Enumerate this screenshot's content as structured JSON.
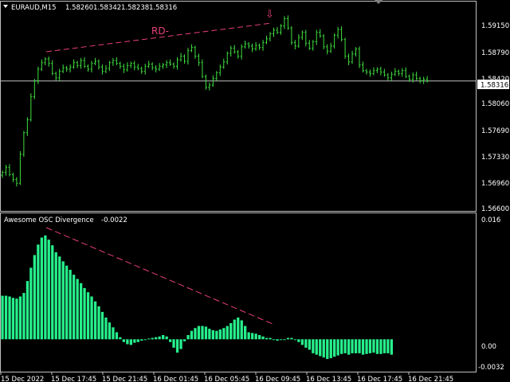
{
  "chart_data": [
    {
      "type": "line",
      "symbol": "EURAUD,M15",
      "ohlc": {
        "open": "1.58260",
        "high": "1.58342",
        "low": "1.58238",
        "close": "1.58316"
      },
      "ylim": [
        1.5655,
        1.5935
      ],
      "y_ticks": [
        "1.59150",
        "1.58790",
        "1.58420",
        "1.58060",
        "1.57690",
        "1.57330",
        "1.56960",
        "1.56600"
      ],
      "current_price_label": "1.58316",
      "current_price": 1.58316,
      "divergence_label": "RD-",
      "arrow_glyph": "⇩",
      "x_tick_labels": [
        "15 Dec 2022",
        "15 Dec 17:45",
        "15 Dec 21:45",
        "16 Dec 01:45",
        "16 Dec 05:45",
        "16 Dec 09:45",
        "16 Dec 13:45",
        "16 Dec 17:45",
        "16 Dec 21:45"
      ],
      "close_series": [
        1.5705,
        1.5712,
        1.5702,
        1.5695,
        1.569,
        1.573,
        1.576,
        1.5778,
        1.581,
        1.5832,
        1.5848,
        1.5857,
        1.5862,
        1.5856,
        1.5842,
        1.5836,
        1.5845,
        1.585,
        1.5848,
        1.5851,
        1.5857,
        1.5853,
        1.586,
        1.5852,
        1.5848,
        1.5856,
        1.5859,
        1.5851,
        1.5845,
        1.5849,
        1.5857,
        1.586,
        1.5856,
        1.5852,
        1.5847,
        1.5853,
        1.5856,
        1.5851,
        1.5849,
        1.5845,
        1.5852,
        1.5855,
        1.585,
        1.5848,
        1.5852,
        1.5854,
        1.5857,
        1.5855,
        1.5852,
        1.5861,
        1.5866,
        1.5859,
        1.5874,
        1.5878,
        1.5866,
        1.5857,
        1.5838,
        1.5823,
        1.5826,
        1.5835,
        1.5843,
        1.5851,
        1.5858,
        1.587,
        1.5877,
        1.5872,
        1.5866,
        1.5879,
        1.5883,
        1.588,
        1.5876,
        1.5881,
        1.5878,
        1.5885,
        1.589,
        1.5897,
        1.5902,
        1.5899,
        1.5908,
        1.5918,
        1.5905,
        1.5885,
        1.588,
        1.5892,
        1.5899,
        1.5884,
        1.5877,
        1.5886,
        1.5899,
        1.5894,
        1.5879,
        1.5873,
        1.588,
        1.5895,
        1.5903,
        1.5889,
        1.5866,
        1.5858,
        1.5869,
        1.5876,
        1.5854,
        1.5846,
        1.5844,
        1.5842,
        1.5846,
        1.5848,
        1.5844,
        1.584,
        1.5836,
        1.5841,
        1.5845,
        1.5842,
        1.5846,
        1.5838,
        1.5834,
        1.584,
        1.5835,
        1.5832,
        1.5834,
        1.5832
      ]
    },
    {
      "type": "bar",
      "indicator_name": "Awesome OSC Divergence",
      "indicator_value": "-0.0022",
      "ylim": [
        -0.0045,
        0.0175
      ],
      "y_ticks": [
        "0.016",
        "0.00",
        "-0.0032"
      ],
      "values": [
        0.0062,
        0.0062,
        0.0061,
        0.0059,
        0.0058,
        0.0061,
        0.0066,
        0.0083,
        0.0102,
        0.012,
        0.0135,
        0.0145,
        0.0148,
        0.0142,
        0.0134,
        0.0124,
        0.0118,
        0.0111,
        0.0105,
        0.0099,
        0.0092,
        0.0086,
        0.008,
        0.0073,
        0.0067,
        0.0061,
        0.0054,
        0.0047,
        0.0039,
        0.0031,
        0.0024,
        0.0017,
        0.001,
        0.0003,
        -0.0004,
        -0.0007,
        -0.0008,
        -0.0005,
        -0.0004,
        -0.0002,
        -0.0001,
        0.0001,
        0.0002,
        0.0003,
        0.0004,
        0.0006,
        0.0004,
        -0.0004,
        -0.0012,
        -0.0019,
        -0.0014,
        -0.0003,
        0.0006,
        0.0012,
        0.0016,
        0.0019,
        0.0019,
        0.0018,
        0.0015,
        0.0013,
        0.0012,
        0.0014,
        0.0016,
        0.0019,
        0.0023,
        0.0028,
        0.0031,
        0.0027,
        0.0019,
        0.001,
        0.0009,
        0.0008,
        0.0006,
        0.0004,
        0.0002,
        0.0002,
        -0.0001,
        -0.0002,
        -0.0001,
        0.0,
        0.0002,
        0.0002,
        0.0,
        -0.0004,
        -0.0008,
        -0.0012,
        -0.0015,
        -0.002,
        -0.0022,
        -0.0024,
        -0.0026,
        -0.0028,
        -0.0027,
        -0.0025,
        -0.0023,
        -0.0021,
        -0.002,
        -0.0022,
        -0.002,
        -0.002,
        -0.002,
        -0.0022,
        -0.0021,
        -0.002,
        -0.0019,
        -0.0021,
        -0.0021,
        -0.002,
        -0.002,
        -0.0022
      ]
    }
  ],
  "colors": {
    "background": "#000000",
    "candles": "#3fe03f",
    "bars": "#26f08c",
    "divergence_line": "#e8407a",
    "grid": "#c0c0c0",
    "text": "#ffffff"
  }
}
